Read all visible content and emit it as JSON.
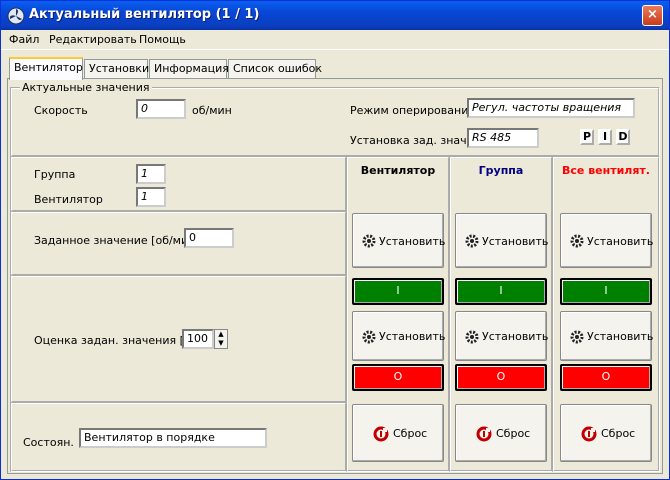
{
  "window": {
    "title": "Актуальный вентилятор (1 / 1)",
    "close_label": "×"
  },
  "menu": {
    "items": [
      "Файл",
      "Редактировать",
      "Помощь"
    ]
  },
  "tabs": [
    "Вентилятор",
    "Установки",
    "Информация",
    "Список ошибок"
  ],
  "actual": {
    "legend": "Актуальные значения",
    "speed_label": "Скорость",
    "speed_value": "0",
    "speed_unit": "об/мин",
    "mode_label": "Режим оперирования",
    "mode_value": "Регул. частоты вращения",
    "setpoint_src_label": "Установка зад. знач.",
    "setpoint_src_value": "RS 485",
    "pid": [
      "P",
      "I",
      "D"
    ]
  },
  "ids": {
    "group_label": "Группа",
    "group_value": "1",
    "fan_label": "Вентилятор",
    "fan_value": "1"
  },
  "setpoint": {
    "label": "Заданное значение [об/мин]",
    "value": "0"
  },
  "rating": {
    "label": "Оценка задан. значения [%]",
    "value": "100"
  },
  "status": {
    "label": "Состоян.",
    "value": "Вентилятор в порядке"
  },
  "columns": [
    {
      "header": "Вентилятор",
      "color": "#000000"
    },
    {
      "header": "Группа",
      "color": "#000080"
    },
    {
      "header": "Все вентилят.",
      "color": "#ff0000"
    }
  ],
  "buttons": {
    "set_label": "Установить",
    "on_label": "I",
    "off_label": "O",
    "reset_label": "Сброс"
  },
  "colors": {
    "on": "#008000",
    "off": "#ff0000",
    "title_bar": "#0a46d6"
  }
}
